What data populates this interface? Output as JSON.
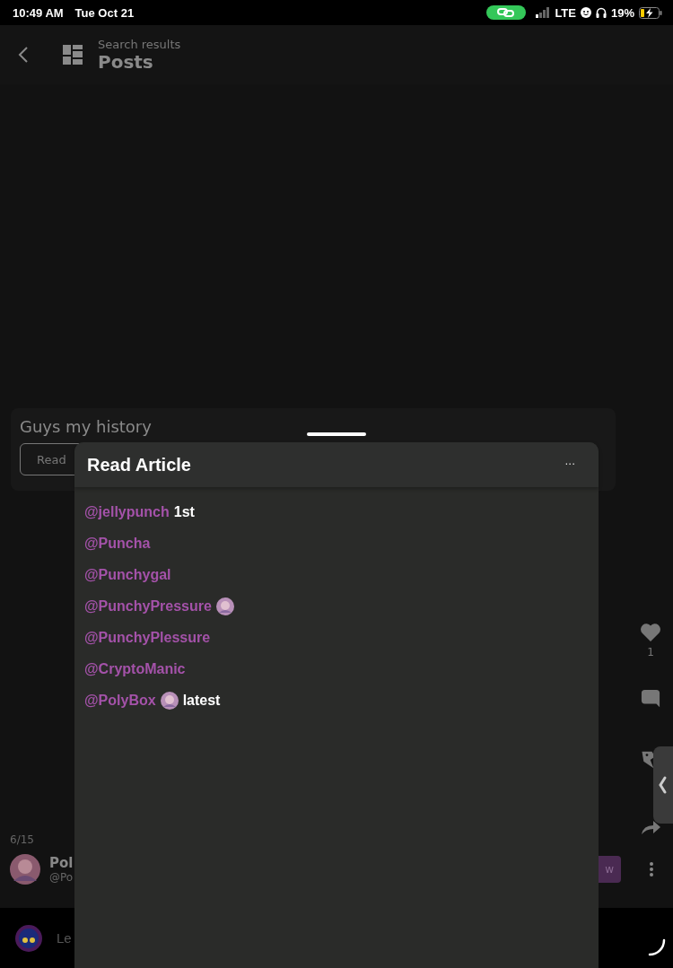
{
  "status_bar": {
    "time": "10:49 AM",
    "date": "Tue Oct 21",
    "network": "LTE",
    "battery": "19%",
    "charging": true
  },
  "header": {
    "subtitle": "Search results",
    "title": "Posts"
  },
  "post": {
    "title": "Guys my history",
    "button": "Read",
    "counter": "6/15",
    "likes": "1",
    "author": {
      "name": "Pol",
      "handle": "@Po"
    },
    "follow_button": "w"
  },
  "comment_bar": {
    "placeholder": "Le"
  },
  "sheet": {
    "title": "Read Article",
    "menu": "···",
    "mentions": [
      {
        "handle": "@jellypunch",
        "has_avatar": false,
        "suffix": "1st"
      },
      {
        "handle": "@Puncha",
        "has_avatar": false
      },
      {
        "handle": "@Punchygal",
        "has_avatar": false
      },
      {
        "handle": "@PunchyPressure",
        "has_avatar": true
      },
      {
        "handle": "@PunchyPlessure",
        "has_avatar": false
      },
      {
        "handle": "@CryptoManic",
        "has_avatar": false
      },
      {
        "handle": "@PolyBox",
        "has_avatar": true,
        "suffix": "latest"
      }
    ]
  }
}
